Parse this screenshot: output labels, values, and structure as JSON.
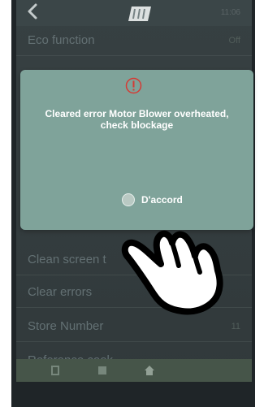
{
  "status_bar": {
    "time": "11:06"
  },
  "settings": {
    "rows": [
      {
        "label": "Eco function",
        "value": "Off"
      },
      {
        "label": "Clean screen t",
        "value": ""
      },
      {
        "label": "Clear errors",
        "value": ""
      },
      {
        "label": "Store Number",
        "value": "11"
      },
      {
        "label": "Reference cook",
        "value": ""
      }
    ]
  },
  "dialog": {
    "message": "Cleared error Motor Blower overheated, check blockage",
    "ok_label": "D'accord",
    "alert_icon": "alert-circle-icon"
  },
  "colors": {
    "dialog_bg": "#7fa39a",
    "alert_red": "#d63a34",
    "screen_bg": "#3a4446"
  }
}
